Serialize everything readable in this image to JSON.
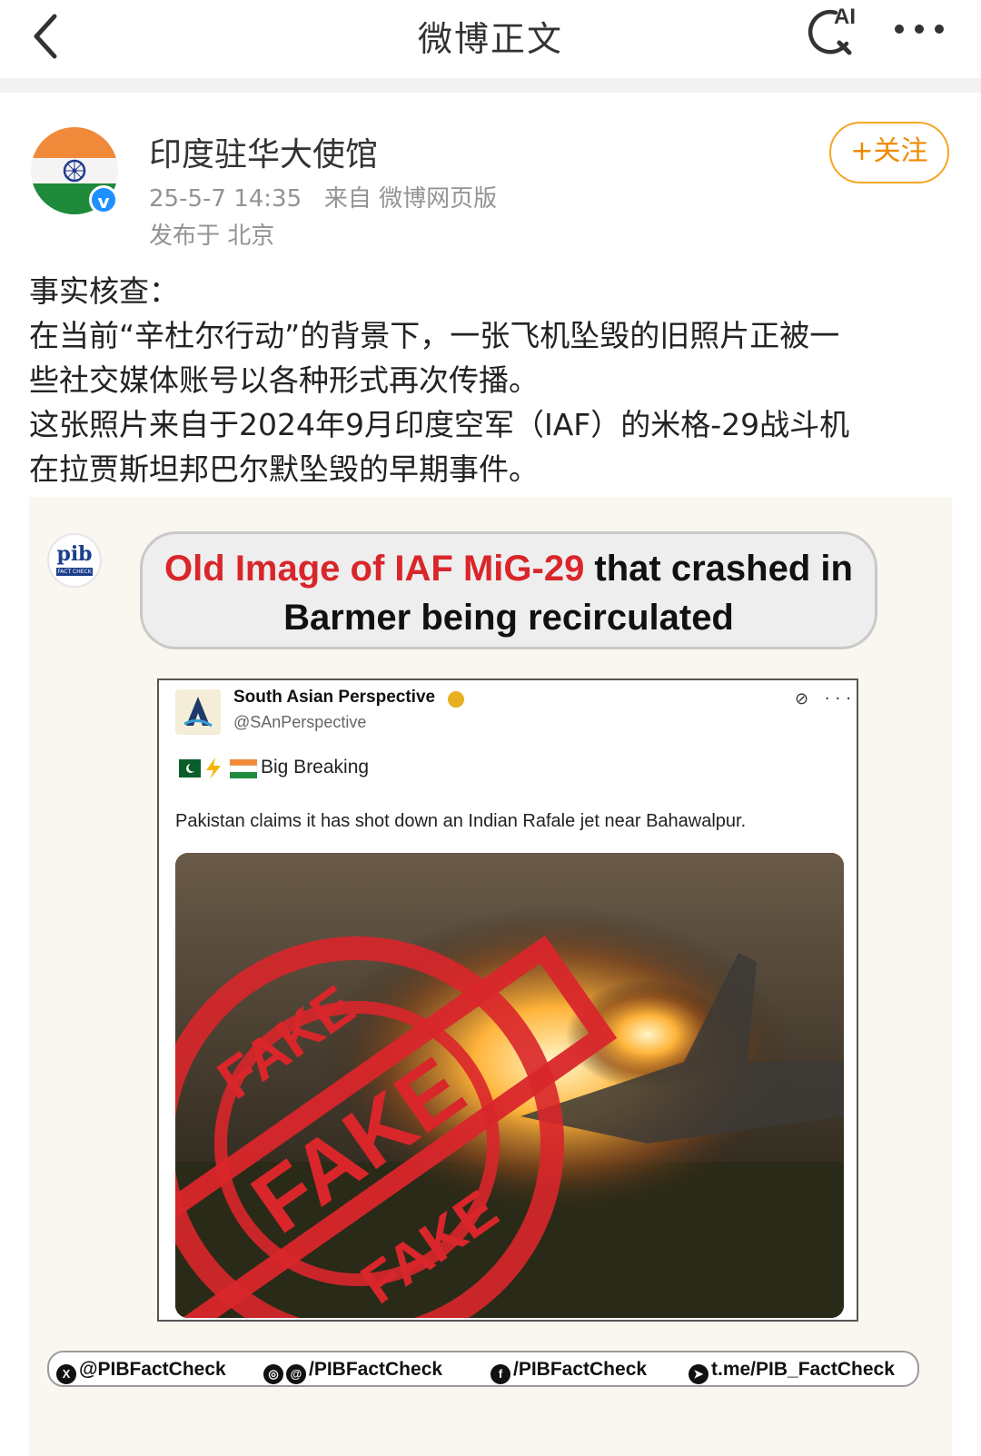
{
  "nav": {
    "title": "微博正文",
    "ai_label": "AI"
  },
  "author": {
    "name": "印度驻华大使馆",
    "verified_mark": "v",
    "meta": "25-5-7 14:35   来自 微博网页版",
    "location": "发布于 北京",
    "follow_label": "+关注"
  },
  "post": {
    "lines": [
      "事实核查：",
      "在当前“辛杜尔行动”的背景下，一张飞机坠毁的旧照片正被一",
      "些社交媒体账号以各种形式再次传播。",
      "这张照片来自于2024年9月印度空军（IAF）的米格-29战斗机",
      "在拉贾斯坦邦巴尔默坠毁的早期事件。"
    ]
  },
  "factcheck_image": {
    "logo_text": "pib",
    "logo_subtext": "FACT CHECK",
    "headline_red": "Old Image of IAF MiG-29",
    "headline_black_1": " that crashed in",
    "headline_black_2": "Barmer being recirculated",
    "tweet": {
      "name": "South Asian Perspective",
      "handle": "@SAnPerspective",
      "menu": "⊘ ···",
      "tag": "Big Breaking",
      "text": "Pakistan claims it has shot down an Indian Rafale jet near Bahawalpur."
    },
    "stamp_words": [
      "FAKE",
      "FAKE",
      "FAKE"
    ],
    "footer": {
      "x": "@PIBFactCheck",
      "insta": "/PIBFactCheck",
      "facebook": "/PIBFactCheck",
      "telegram": "t.me/PIB_FactCheck"
    }
  },
  "colors": {
    "follow": "#f08a00",
    "stamp_red": "#d9262b",
    "verified": "#1e90ff"
  }
}
